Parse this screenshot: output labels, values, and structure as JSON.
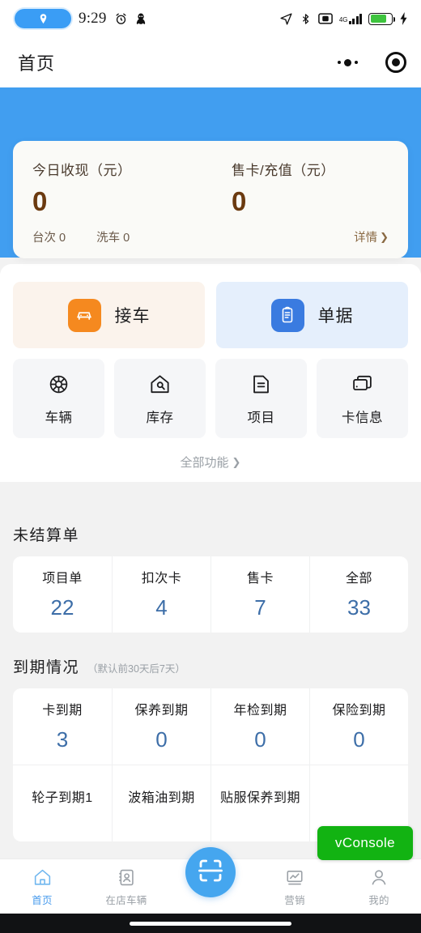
{
  "status_bar": {
    "time": "9:29",
    "network_label": "4G",
    "battery_text": "",
    "icons": [
      "location-pill-icon",
      "alarm-icon",
      "qq-penguin-icon",
      "navigation-arrow-icon",
      "bluetooth-icon",
      "screenshot-icon",
      "signal-icon",
      "battery-icon",
      "charging-bolt-icon"
    ]
  },
  "navbar": {
    "title": "首页",
    "capsule": {
      "more": "•••",
      "target": "target-icon"
    }
  },
  "summary": {
    "cash_label": "今日收现（元）",
    "cash_value": "0",
    "card_label": "售卡/充值（元）",
    "card_value": "0",
    "visits_label": "台次 0",
    "wash_label": "洗车 0",
    "detail_label": "详情",
    "detail_chevron": "❯"
  },
  "functions": {
    "primary": [
      {
        "label": "接车",
        "icon": "car-icon",
        "icon_color": "#f5891f",
        "bg": "#fbf3ec"
      },
      {
        "label": "单据",
        "icon": "clipboard-icon",
        "icon_color": "#3a7be0",
        "bg": "#e5effc"
      }
    ],
    "secondary": [
      {
        "label": "车辆",
        "icon": "wheel-icon"
      },
      {
        "label": "库存",
        "icon": "warehouse-icon"
      },
      {
        "label": "项目",
        "icon": "document-icon"
      },
      {
        "label": "卡信息",
        "icon": "card-stack-icon"
      }
    ],
    "all_label": "全部功能",
    "all_chevron": "❯"
  },
  "unsettled": {
    "title": "未结算单",
    "items": [
      {
        "name": "项目单",
        "value": "22"
      },
      {
        "name": "扣次卡",
        "value": "4"
      },
      {
        "name": "售卡",
        "value": "7"
      },
      {
        "name": "全部",
        "value": "33"
      }
    ]
  },
  "expiry": {
    "title": "到期情况",
    "subtitle": "（默认前30天后7天）",
    "row1": [
      {
        "name": "卡到期",
        "value": "3"
      },
      {
        "name": "保养到期",
        "value": "0"
      },
      {
        "name": "年检到期",
        "value": "0"
      },
      {
        "name": "保险到期",
        "value": "0"
      }
    ],
    "row2": [
      {
        "name": "轮子到期1",
        "value": ""
      },
      {
        "name": "波箱油到期",
        "value": ""
      },
      {
        "name": "贴服保养到期",
        "value": ""
      },
      {
        "name": "",
        "value": ""
      }
    ]
  },
  "debug": {
    "vconsole_label": "vConsole"
  },
  "tabbar": {
    "items": [
      {
        "label": "首页",
        "icon": "home-icon",
        "active": true
      },
      {
        "label": "在店车辆",
        "icon": "contact-card-icon",
        "active": false
      },
      {
        "label": "营销",
        "icon": "chart-icon",
        "active": false
      },
      {
        "label": "我的",
        "icon": "person-icon",
        "active": false
      }
    ],
    "fab": {
      "icon": "scan-icon"
    }
  },
  "colors": {
    "brand_blue": "#419ef0",
    "accent_orange": "#f5891f",
    "accent_blue": "#3a7be0",
    "value_brown": "#6b3a10",
    "stat_blue": "#3d6ea8",
    "vconsole_green": "#12b312"
  }
}
